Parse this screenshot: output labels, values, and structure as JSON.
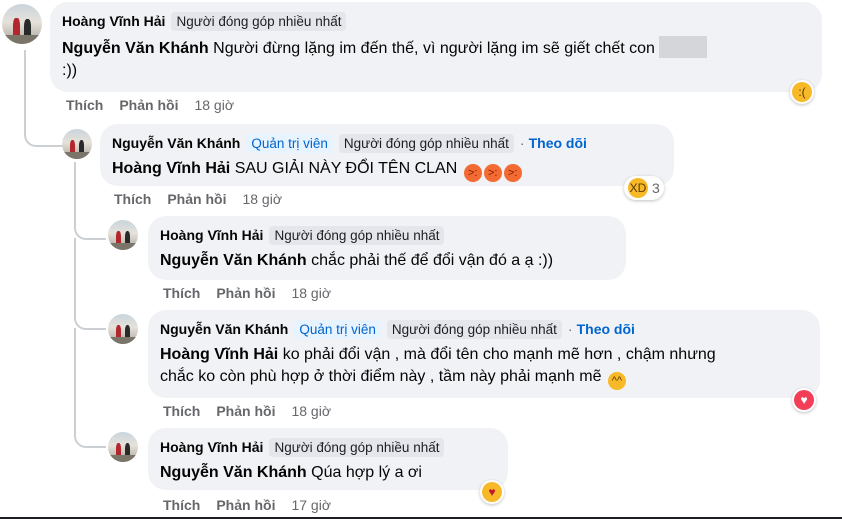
{
  "comments": [
    {
      "author": "Hoàng Vĩnh Hải",
      "badges": [
        "Người đóng góp nhiều nhất"
      ],
      "mention": "Nguyễn Văn Khánh",
      "text_line1": "Người đừng lặng im đến thế, vì người lặng im sẽ giết chết con",
      "text_line2": ":))",
      "like": "Thích",
      "reply": "Phản hồi",
      "time": "18 giờ",
      "reaction": "sad-icon"
    },
    {
      "author": "Nguyễn Văn Khánh",
      "badge_admin": "Quản trị viên",
      "badge_top": "Người đóng góp nhiều nhất",
      "follow": "Theo dõi",
      "mention": "Hoàng Vĩnh Hải",
      "text": "SAU GIẢI NÀY ĐỔI TÊN CLAN",
      "emoji": [
        "angry-face-icon",
        "angry-face-icon",
        "angry-face-icon"
      ],
      "like": "Thích",
      "reply": "Phản hồi",
      "time": "18 giờ",
      "reaction": "laugh-icon",
      "reaction_count": "3"
    },
    {
      "author": "Hoàng Vĩnh Hải",
      "badge_top": "Người đóng góp nhiều nhất",
      "mention": "Nguyễn Văn Khánh",
      "text": "chắc phải thế để đổi vận đó a ạ :))",
      "like": "Thích",
      "reply": "Phản hồi",
      "time": "18 giờ"
    },
    {
      "author": "Nguyễn Văn Khánh",
      "badge_admin": "Quản trị viên",
      "badge_top": "Người đóng góp nhiều nhất",
      "follow": "Theo dõi",
      "mention": "Hoàng Vĩnh Hải",
      "text_line1": "ko phải đổi vận , mà đổi tên cho mạnh mẽ hơn , chậm nhưng",
      "text_line2": "chắc ko còn phù hợp ở thời điểm này , tầm này phải mạnh mẽ",
      "emoji": "grinning-sweat-icon",
      "like": "Thích",
      "reply": "Phản hồi",
      "time": "18 giờ",
      "reaction": "heart-icon"
    },
    {
      "author": "Hoàng Vĩnh Hải",
      "badge_top": "Người đóng góp nhiều nhất",
      "mention": "Nguyễn Văn Khánh",
      "text": "Qúa hợp lý a ơi",
      "like": "Thích",
      "reply": "Phản hồi",
      "time": "17 giờ",
      "reaction": "care-icon"
    }
  ],
  "colors": {
    "bubble": "#f0f2f5",
    "link_blue": "#0064d1",
    "admin_badge_bg": "#e7f3ff",
    "meta_gray": "#65676b",
    "heart": "#f33e58"
  }
}
